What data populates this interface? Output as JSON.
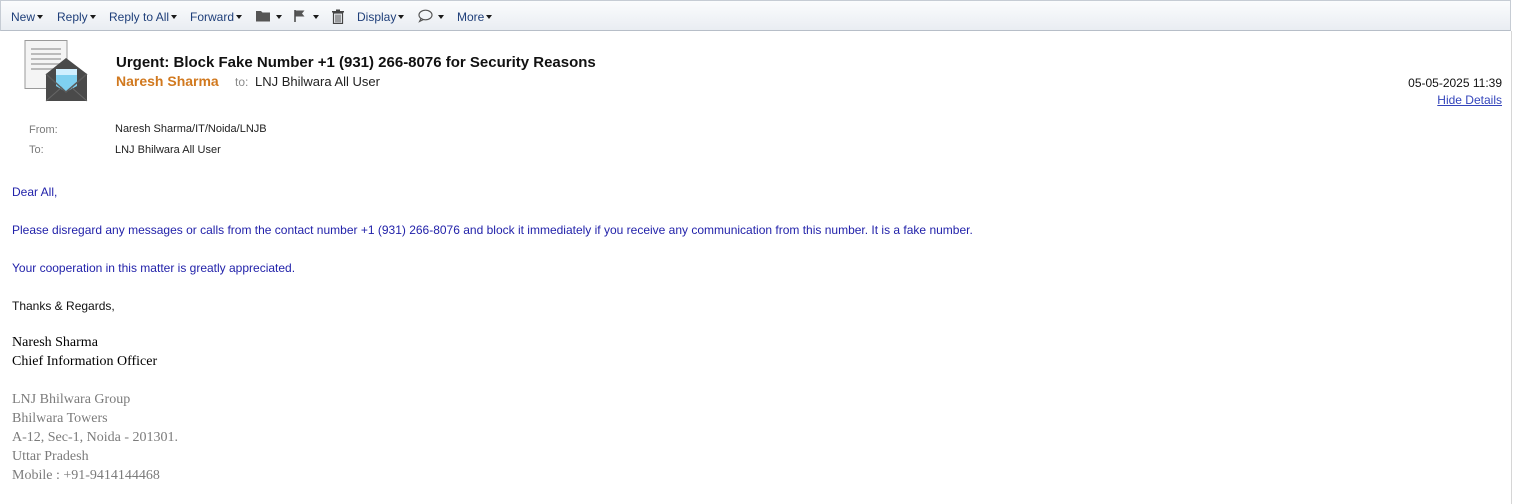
{
  "toolbar": {
    "new": "New",
    "reply": "Reply",
    "reply_all": "Reply to All",
    "forward": "Forward",
    "folder_icon": "folder-icon",
    "flag_icon": "flag-icon",
    "trash_icon": "trash-icon",
    "display": "Display",
    "chat_icon": "chat-bubble-icon",
    "more": "More"
  },
  "header": {
    "icon": "envelope-document-icon",
    "subject": "Urgent: Block Fake Number +1 (931) 266-8076 for Security Reasons",
    "sender_name": "Naresh Sharma",
    "to_label": "to:",
    "to_value": "LNJ Bhilwara All User",
    "date": "05-05-2025 11:39",
    "hide_details": "Hide Details"
  },
  "details": {
    "from_label": "From:",
    "from_value": "Naresh Sharma/IT/Noida/LNJB",
    "to_label": "To:",
    "to_value": "LNJ Bhilwara All User"
  },
  "body": {
    "greeting": "Dear All,",
    "paragraph1": "Please disregard any messages or calls from the contact number +1 (931) 266-8076 and block it immediately if you receive any communication from this number. It is a fake number.",
    "paragraph2": "Your cooperation in this matter is greatly appreciated.",
    "closing": "Thanks & Regards,"
  },
  "signature": {
    "name": "Naresh Sharma",
    "title": "Chief Information Officer",
    "company": "LNJ Bhilwara Group",
    "building": "Bhilwara Towers",
    "address": "A-12, Sec-1, Noida - 201301.",
    "state": "Uttar Pradesh",
    "mobile": "Mobile : +91-9414144468"
  },
  "colors": {
    "sender": "#d1791f",
    "body_text": "#2222aa",
    "link": "#3344bb",
    "toolbar_text": "#1f3f7a"
  }
}
